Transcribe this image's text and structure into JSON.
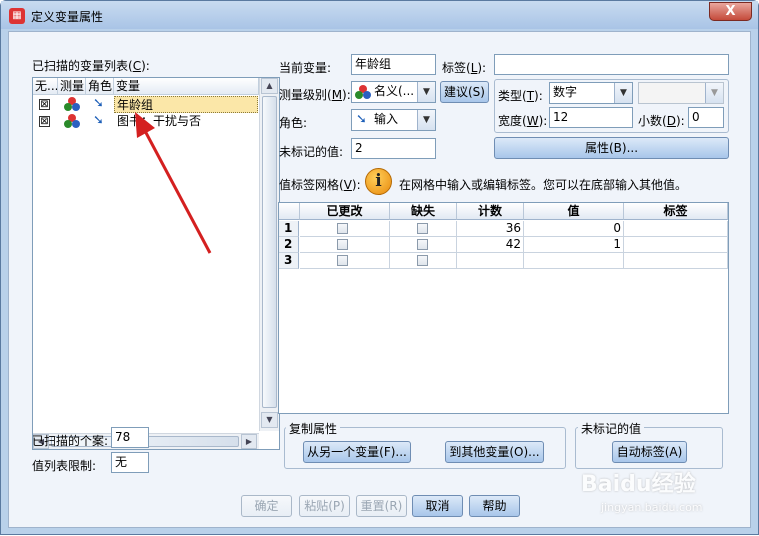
{
  "window": {
    "title": "定义变量属性",
    "close_label": "X"
  },
  "scanned_list": {
    "label": "已扫描的变量列表(",
    "label_key": "C",
    "label_end": "):",
    "headers": [
      "无...",
      "测量",
      "角色",
      "变量"
    ],
    "rows": [
      {
        "checked": "⊠",
        "name": "年龄组"
      },
      {
        "checked": "⊠",
        "name": "图书：干扰与否"
      }
    ]
  },
  "cases": {
    "label": "已扫描的个案:",
    "value": "78"
  },
  "value_limit": {
    "label": "值列表限制:",
    "value": "无"
  },
  "current_var": {
    "label": "当前变量:",
    "value": "年龄组"
  },
  "tag": {
    "label": "标签(",
    "key": "L",
    "end": "):",
    "value": ""
  },
  "measure": {
    "label": "测量级别(",
    "key": "M",
    "end": "):",
    "value": "名义(..."
  },
  "suggest_button": "建议(S)",
  "role": {
    "label": "角色:",
    "value": "输入"
  },
  "unmarked": {
    "label": "未标记的值:",
    "value": "2"
  },
  "type": {
    "label": "类型(",
    "key": "T",
    "end": "):",
    "value": "数字"
  },
  "width": {
    "label": "宽度(",
    "key": "W",
    "end": "):",
    "value": "12"
  },
  "decimals": {
    "label": "小数(",
    "key": "D",
    "end": "):",
    "value": "0"
  },
  "attributes_button": "属性(B)...",
  "grid_label": {
    "text": "值标签网格(",
    "key": "V",
    "end": "):",
    "hint": "在网格中输入或编辑标签。您可以在底部输入其他值。"
  },
  "grid": {
    "headers": [
      "已更改",
      "缺失",
      "计数",
      "值",
      "标签"
    ],
    "rows": [
      {
        "num": "1",
        "count": "36",
        "value": "0",
        "label": ""
      },
      {
        "num": "2",
        "count": "42",
        "value": "1",
        "label": ""
      },
      {
        "num": "3",
        "count": "",
        "value": "",
        "label": ""
      }
    ]
  },
  "copy_group": {
    "title": "复制属性",
    "from_button": "从另一个变量(F)...",
    "to_button": "到其他变量(O)..."
  },
  "unmarked_group": {
    "title": "未标记的值",
    "auto_button": "自动标签(A)"
  },
  "footer": {
    "ok": "确定",
    "paste": "粘贴(P)",
    "reset": "重置(R)",
    "cancel": "取消",
    "help": "帮助"
  },
  "watermark": {
    "text": "Baidu经验",
    "sub": "jingyan.baidu.com"
  },
  "colors": {
    "accent": "#1d5fb8",
    "arrow": "#d42020",
    "selected_row": "#fbe7a8"
  }
}
